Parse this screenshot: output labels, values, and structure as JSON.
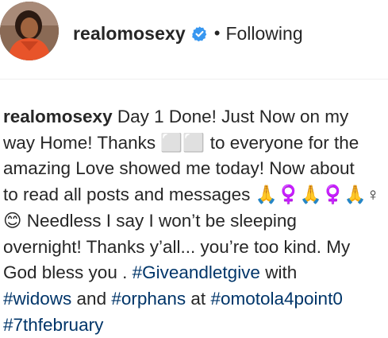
{
  "header": {
    "username": "realomosexy",
    "separator": "•",
    "follow_status": "Following"
  },
  "caption": {
    "username": "realomosexy",
    "lines": [
      "Day 1 Done! Just Now on my",
      "way Home! Thanks ⬜⬜ to everyone for the",
      "amazing Love showed me today! Now about",
      "to read all posts and messages 🙏♀️🙏♀️🙏♀",
      "😊 Needless I say I won’t be sleeping",
      "overnight! Thanks y’all... you’re too kind. My",
      "God bless you . "
    ],
    "line7_tag": "#Giveandletgive",
    "line7_after": " with",
    "line8_tag1": "#widows",
    "line8_and": " and ",
    "line8_tag2": "#orphans",
    "line8_at": " at ",
    "line8_tag3": "#omotola4point0",
    "line9_tag": "#7thfebruary"
  },
  "colors": {
    "hashtag": "#003569",
    "text": "#262626",
    "verified": "#3897f0"
  },
  "icons": {
    "verified": "verified-badge-icon"
  }
}
